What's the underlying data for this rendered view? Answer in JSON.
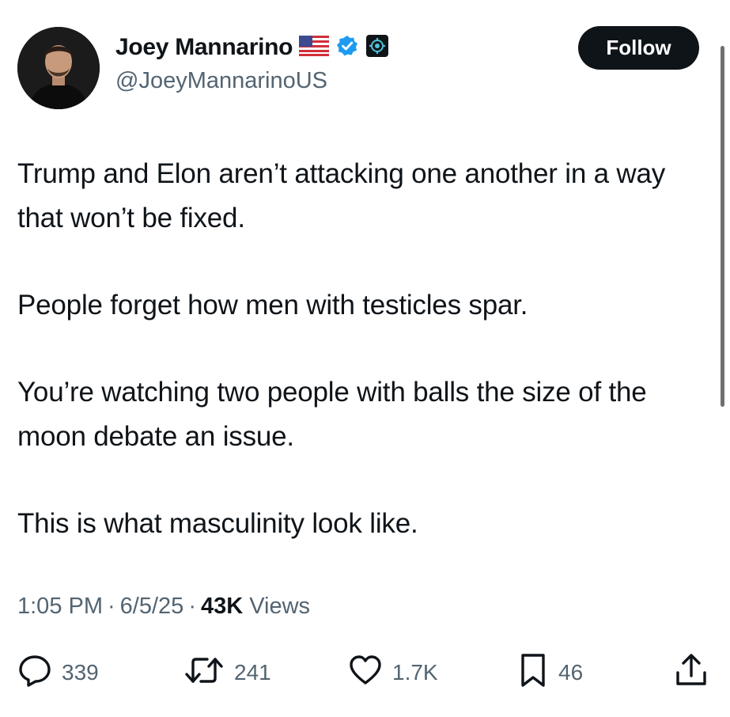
{
  "author": {
    "display_name": "Joey Mannarino",
    "handle": "@JoeyMannarinoUS",
    "badges": [
      "us-flag-icon",
      "verified-badge-icon",
      "affiliate-badge-icon"
    ]
  },
  "follow_label": "Follow",
  "tweet": {
    "paragraphs": [
      "Trump and Elon aren’t attacking one another in a way that won’t be fixed.",
      "People forget how men with testicles spar.",
      "You’re watching two people with balls the size of the moon debate an issue.",
      "This is what masculinity look like."
    ]
  },
  "meta": {
    "time": "1:05 PM",
    "date": "6/5/25",
    "views_count": "43K",
    "views_label": "Views",
    "separator": "·"
  },
  "actions": {
    "replies": "339",
    "reposts": "241",
    "likes": "1.7K",
    "bookmarks": "46"
  },
  "colors": {
    "text": "#0f1419",
    "secondary": "#536471",
    "verified": "#1d9bf0",
    "follow_bg": "#0f1419"
  }
}
